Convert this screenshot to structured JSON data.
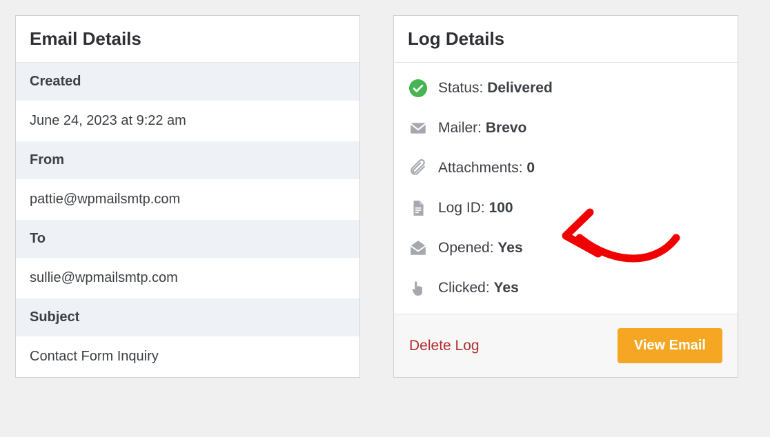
{
  "emailDetails": {
    "title": "Email Details",
    "created_label": "Created",
    "created_value": "June 24, 2023 at 9:22 am",
    "from_label": "From",
    "from_value": "pattie@wpmailsmtp.com",
    "to_label": "To",
    "to_value": "sullie@wpmailsmtp.com",
    "subject_label": "Subject",
    "subject_value": "Contact Form Inquiry"
  },
  "logDetails": {
    "title": "Log Details",
    "status_label": "Status:",
    "status_value": "Delivered",
    "mailer_label": "Mailer:",
    "mailer_value": "Brevo",
    "attachments_label": "Attachments:",
    "attachments_value": "0",
    "log_id_label": "Log ID:",
    "log_id_value": "100",
    "opened_label": "Opened:",
    "opened_value": "Yes",
    "clicked_label": "Clicked:",
    "clicked_value": "Yes",
    "delete_label": "Delete Log",
    "view_label": "View Email"
  },
  "colors": {
    "status_ok": "#46b450",
    "icon_gray": "#a5a8ad",
    "accent": "#f5a623",
    "danger": "#b32d2e",
    "annotation": "#f00000"
  }
}
